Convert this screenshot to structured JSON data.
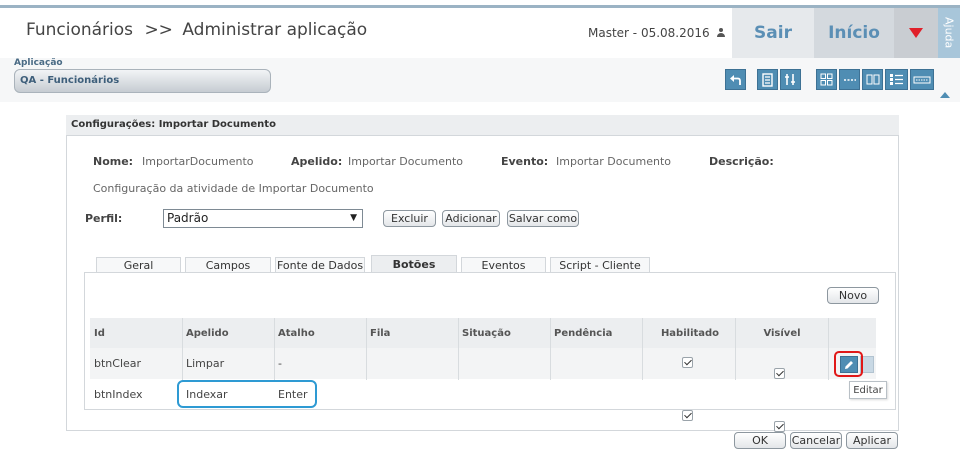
{
  "header": {
    "title": "Funcionários",
    "separator": ">>",
    "subtitle": "Administrar aplicação",
    "user": "Master - 05.08.2016",
    "sair": "Sair",
    "inicio": "Início",
    "ajuda": "Ajuda",
    "colors": {
      "accent": "#5b8fb5",
      "dropdown": "#e0202a",
      "toolbar": "#4f8db3"
    }
  },
  "app": {
    "label": "Aplicação",
    "value": "QA - Funcionários"
  },
  "toolbar": {
    "icons": [
      "undo-icon",
      "document-icon",
      "tools-icon",
      "layout-grid-icon",
      "dashes-icon",
      "copy-icon",
      "list-icon",
      "bar-icon"
    ]
  },
  "panel": {
    "title": "Configurações: Importar Documento",
    "nome_label": "Nome:",
    "nome_value": "ImportarDocumento",
    "apelido_label": "Apelido:",
    "apelido_value": "Importar Documento",
    "evento_label": "Evento:",
    "evento_value": "Importar Documento",
    "descricao_label": "Descrição:",
    "descricao_text": "Configuração da atividade de Importar Documento",
    "perfil_label": "Perfil:",
    "perfil_value": "Padrão",
    "excluir": "Excluir",
    "adicionar": "Adicionar",
    "salvar_como": "Salvar como"
  },
  "tabs": [
    "Geral",
    "Campos",
    "Fonte de Dados",
    "Botões",
    "Eventos",
    "Script - Cliente"
  ],
  "active_tab": "Botões",
  "grid": {
    "novo": "Novo",
    "columns": [
      "Id",
      "Apelido",
      "Atalho",
      "Fila",
      "Situação",
      "Pendência",
      "Habilitado",
      "Visível"
    ],
    "rows": [
      {
        "id": "btnClear",
        "apelido": "Limpar",
        "atalho": "-",
        "fila": "",
        "situacao": "",
        "pendencia": "",
        "habilitado": true,
        "visivel": true
      },
      {
        "id": "btnIndex",
        "apelido": "Indexar",
        "atalho": "Enter",
        "fila": "",
        "situacao": "",
        "pendencia": "",
        "habilitado": true,
        "visivel": true
      }
    ],
    "edit_tooltip": "Editar"
  },
  "footer": {
    "ok": "OK",
    "cancelar": "Cancelar",
    "aplicar": "Aplicar"
  }
}
